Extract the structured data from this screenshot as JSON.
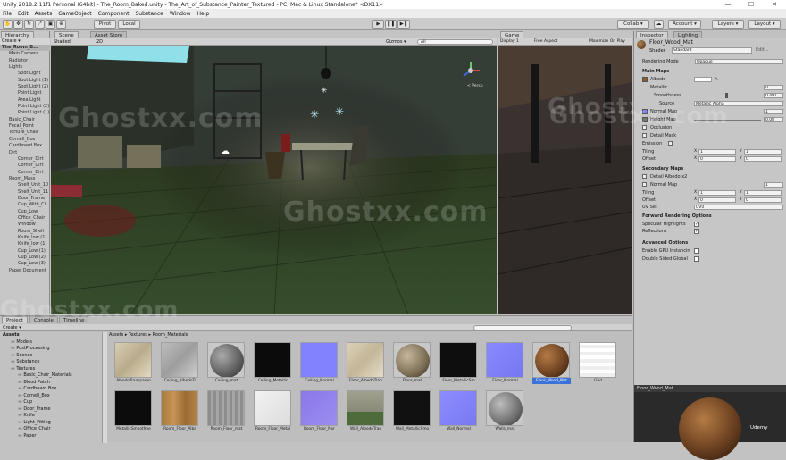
{
  "window": {
    "title": "Unity 2018.2.11f1 Personal (64bit) - The_Room_Baked.unity - The_Art_of_Substance_Painter_Textured - PC, Mac & Linux Standalone* <DX11>",
    "minimize": "—",
    "maximize": "☐",
    "close": "✕"
  },
  "menu": [
    "File",
    "Edit",
    "Assets",
    "GameObject",
    "Component",
    "Substance",
    "Window",
    "Help"
  ],
  "toolbar": {
    "pivot": "Pivot",
    "local": "Local",
    "play": "▶",
    "pause": "❚❚",
    "step": "▶❚",
    "collab": "Collab ▾",
    "account": "Account ▾",
    "layers": "Layers ▾",
    "layout": "Layout ▾"
  },
  "hierarchy": {
    "tab": "Hierarchy",
    "create": "Create ▾",
    "root": "The_Room_B...",
    "items": [
      "Main Camera",
      "Radiator",
      "Lights",
      "Spot Light",
      "Spot Light (1)",
      "Spot Light (2)",
      "Point Light",
      "Area Light",
      "Point Light (2)",
      "Point Light (1)",
      "Basic_Chair",
      "Focal_Point",
      "Torture_Chair",
      "Cornell_Box",
      "Cardboard Box",
      "Dirt",
      "Corner_Dirt",
      "Corner_Dirt",
      "Corner_Dirt",
      "Room_Mass",
      "Shelf_Unit_10",
      "Shelf_Unit_11",
      "Door_Frame",
      "Cup_With_Cl",
      "Cup_Low",
      "Office_Chair",
      "Window",
      "Room_Shell",
      "Knife_low (1)",
      "Knife_low (1)",
      "Cup_Low (1)",
      "Cup_Low (2)",
      "Cup_Low (3)",
      "Paper Document"
    ]
  },
  "scene": {
    "tab": "Scene",
    "asset_store": "Asset Store",
    "shading": "Shaded",
    "mode_2d": "2D",
    "gizmos": "Gizmos ▾",
    "search": "All",
    "persp": "< Persp"
  },
  "game": {
    "tab": "Game",
    "display": "Display 1",
    "aspect": "Free Aspect",
    "maximize": "Maximize On Play"
  },
  "inspector": {
    "tab": "Inspector",
    "lighting_tab": "Lighting",
    "material_name": "Floor_Wood_Mat",
    "shader_label": "Shader",
    "shader_value": "Standard",
    "rendering_mode_label": "Rendering Mode",
    "rendering_mode_value": "Opaque",
    "main_maps": "Main Maps",
    "albedo": "Albedo",
    "metallic": "Metallic",
    "metallic_value": "0",
    "smoothness": "Smoothness",
    "smoothness_value": "0.491",
    "source": "Source",
    "source_value": "Metallic Alpha",
    "normal_map": "Normal Map",
    "normal_value": "1",
    "height_map": "Height Map",
    "height_value": "0.08",
    "occlusion": "Occlusion",
    "detail_mask": "Detail Mask",
    "emission": "Emission",
    "tiling": "Tiling",
    "offset": "Offset",
    "tiling_x": "1",
    "tiling_y": "1",
    "offset_x": "0",
    "offset_y": "0",
    "secondary_maps": "Secondary Maps",
    "detail_albedo": "Detail Albedo x2",
    "sec_normal_map": "Normal Map",
    "sec_normal_value": "1",
    "sec_tiling_x": "1",
    "sec_tiling_y": "1",
    "sec_offset_x": "0",
    "sec_offset_y": "0",
    "uv_set": "UV Set",
    "uv_set_value": "UV0",
    "forward_options": "Forward Rendering Options",
    "specular_highlights": "Specular Highlights",
    "reflections": "Reflections",
    "advanced_options": "Advanced Options",
    "gpu_instancing": "Enable GPU Instancin",
    "double_sided": "Double Sided Global",
    "preview_title": "Floor_Wood_Mat",
    "udemy": "Udemy"
  },
  "project": {
    "tabs": [
      "Project",
      "Console",
      "Timeline"
    ],
    "create": "Create ▾",
    "breadcrumb": [
      "Assets",
      "Textures",
      "Room_Materials"
    ],
    "tree_root": "Assets",
    "tree": [
      "Models",
      "PostProcessing",
      "Scenes",
      "Substance",
      "Textures",
      "Basic_Chair_Materials",
      "Blood Patch",
      "Cardboard Box",
      "Cornell_Box",
      "Cup",
      "Door_Frame",
      "Knife",
      "Light_Fitting",
      "Office_Chair",
      "Paper"
    ],
    "assets_row1": [
      "AlbedoTransparen",
      "Ceiling_AlbedoTr",
      "Ceiling_mat",
      "Ceiling_Metallic",
      "Ceiling_Normal",
      "Floor_AlbedoTran",
      "Floor_mat",
      "Floor_MetallicSm",
      "Floor_Normal",
      "Floor_Wood_Mat",
      "Grid"
    ],
    "assets_row2": [
      "MetallicSmoothne",
      "Room_Floor_Albe",
      "Room_Floor_mat",
      "Room_Floor_Metal",
      "Room_Floor_Nor",
      "Wall_AlbedoTran",
      "Wall_MetallicSmo",
      "Wall_Normal",
      "Walls_mat"
    ]
  },
  "watermark": "Ghostxx.com",
  "colors": {
    "selection": "#3a72d8",
    "normal_map": "#8080ff",
    "play_blue": "#2c5fb3"
  }
}
